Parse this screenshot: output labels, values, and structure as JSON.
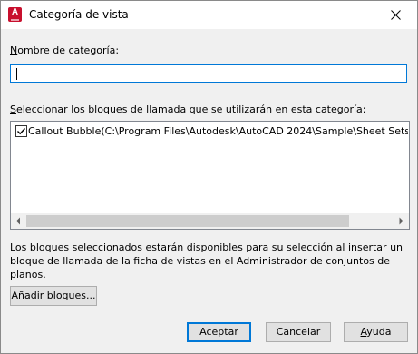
{
  "window": {
    "title": "Categoría de vista",
    "app_icon": "autocad-icon",
    "app_icon_letter": "A"
  },
  "name_field": {
    "label_accel": "N",
    "label_rest": "ombre de categoría:",
    "value": ""
  },
  "blocks": {
    "label_accel": "S",
    "label_rest": "eleccionar los bloques de llamada que se utilizarán en esta categoría:",
    "items": [
      {
        "checked": true,
        "text": "Callout Bubble(C:\\Program Files\\Autodesk\\AutoCAD 2024\\Sample\\Sheet Sets\\Architectu"
      }
    ]
  },
  "info_text": "Los bloques seleccionados estarán disponibles para su selección al insertar un bloque de llamada de la ficha de vistas en el Administrador de conjuntos de planos.",
  "buttons": {
    "add_blocks_pre": "Añ",
    "add_blocks_accel": "a",
    "add_blocks_post": "dir bloques...",
    "accept": "Aceptar",
    "cancel": "Cancelar",
    "help_accel": "A",
    "help_rest": "yuda"
  },
  "colors": {
    "accent": "#0078d7",
    "app_icon": "#c8102e"
  }
}
